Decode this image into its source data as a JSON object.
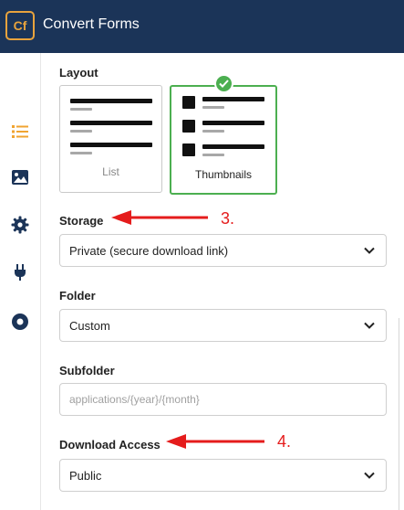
{
  "app": {
    "logo_text": "Cf",
    "title": "Convert Forms"
  },
  "sidebar": {
    "items": [
      {
        "icon": "list-icon",
        "active": true
      },
      {
        "icon": "image-icon"
      },
      {
        "icon": "gear-icon"
      },
      {
        "icon": "plug-icon"
      },
      {
        "icon": "circle-icon"
      }
    ]
  },
  "layout": {
    "label": "Layout",
    "options": [
      {
        "label": "List",
        "selected": false
      },
      {
        "label": "Thumbnails",
        "selected": true
      }
    ]
  },
  "storage": {
    "label": "Storage",
    "value": "Private (secure download link)"
  },
  "folder": {
    "label": "Folder",
    "value": "Custom"
  },
  "subfolder": {
    "label": "Subfolder",
    "value": "",
    "placeholder": "applications/{year}/{month}"
  },
  "download_access": {
    "label": "Download Access",
    "value": "Public"
  },
  "annotations": [
    {
      "text": "3.",
      "color": "#e51c1c"
    },
    {
      "text": "4.",
      "color": "#e51c1c"
    }
  ],
  "colors": {
    "header": "#1b3458",
    "logo": "#e8a33d",
    "accent": "#f0a431",
    "selected": "#4caf50"
  }
}
